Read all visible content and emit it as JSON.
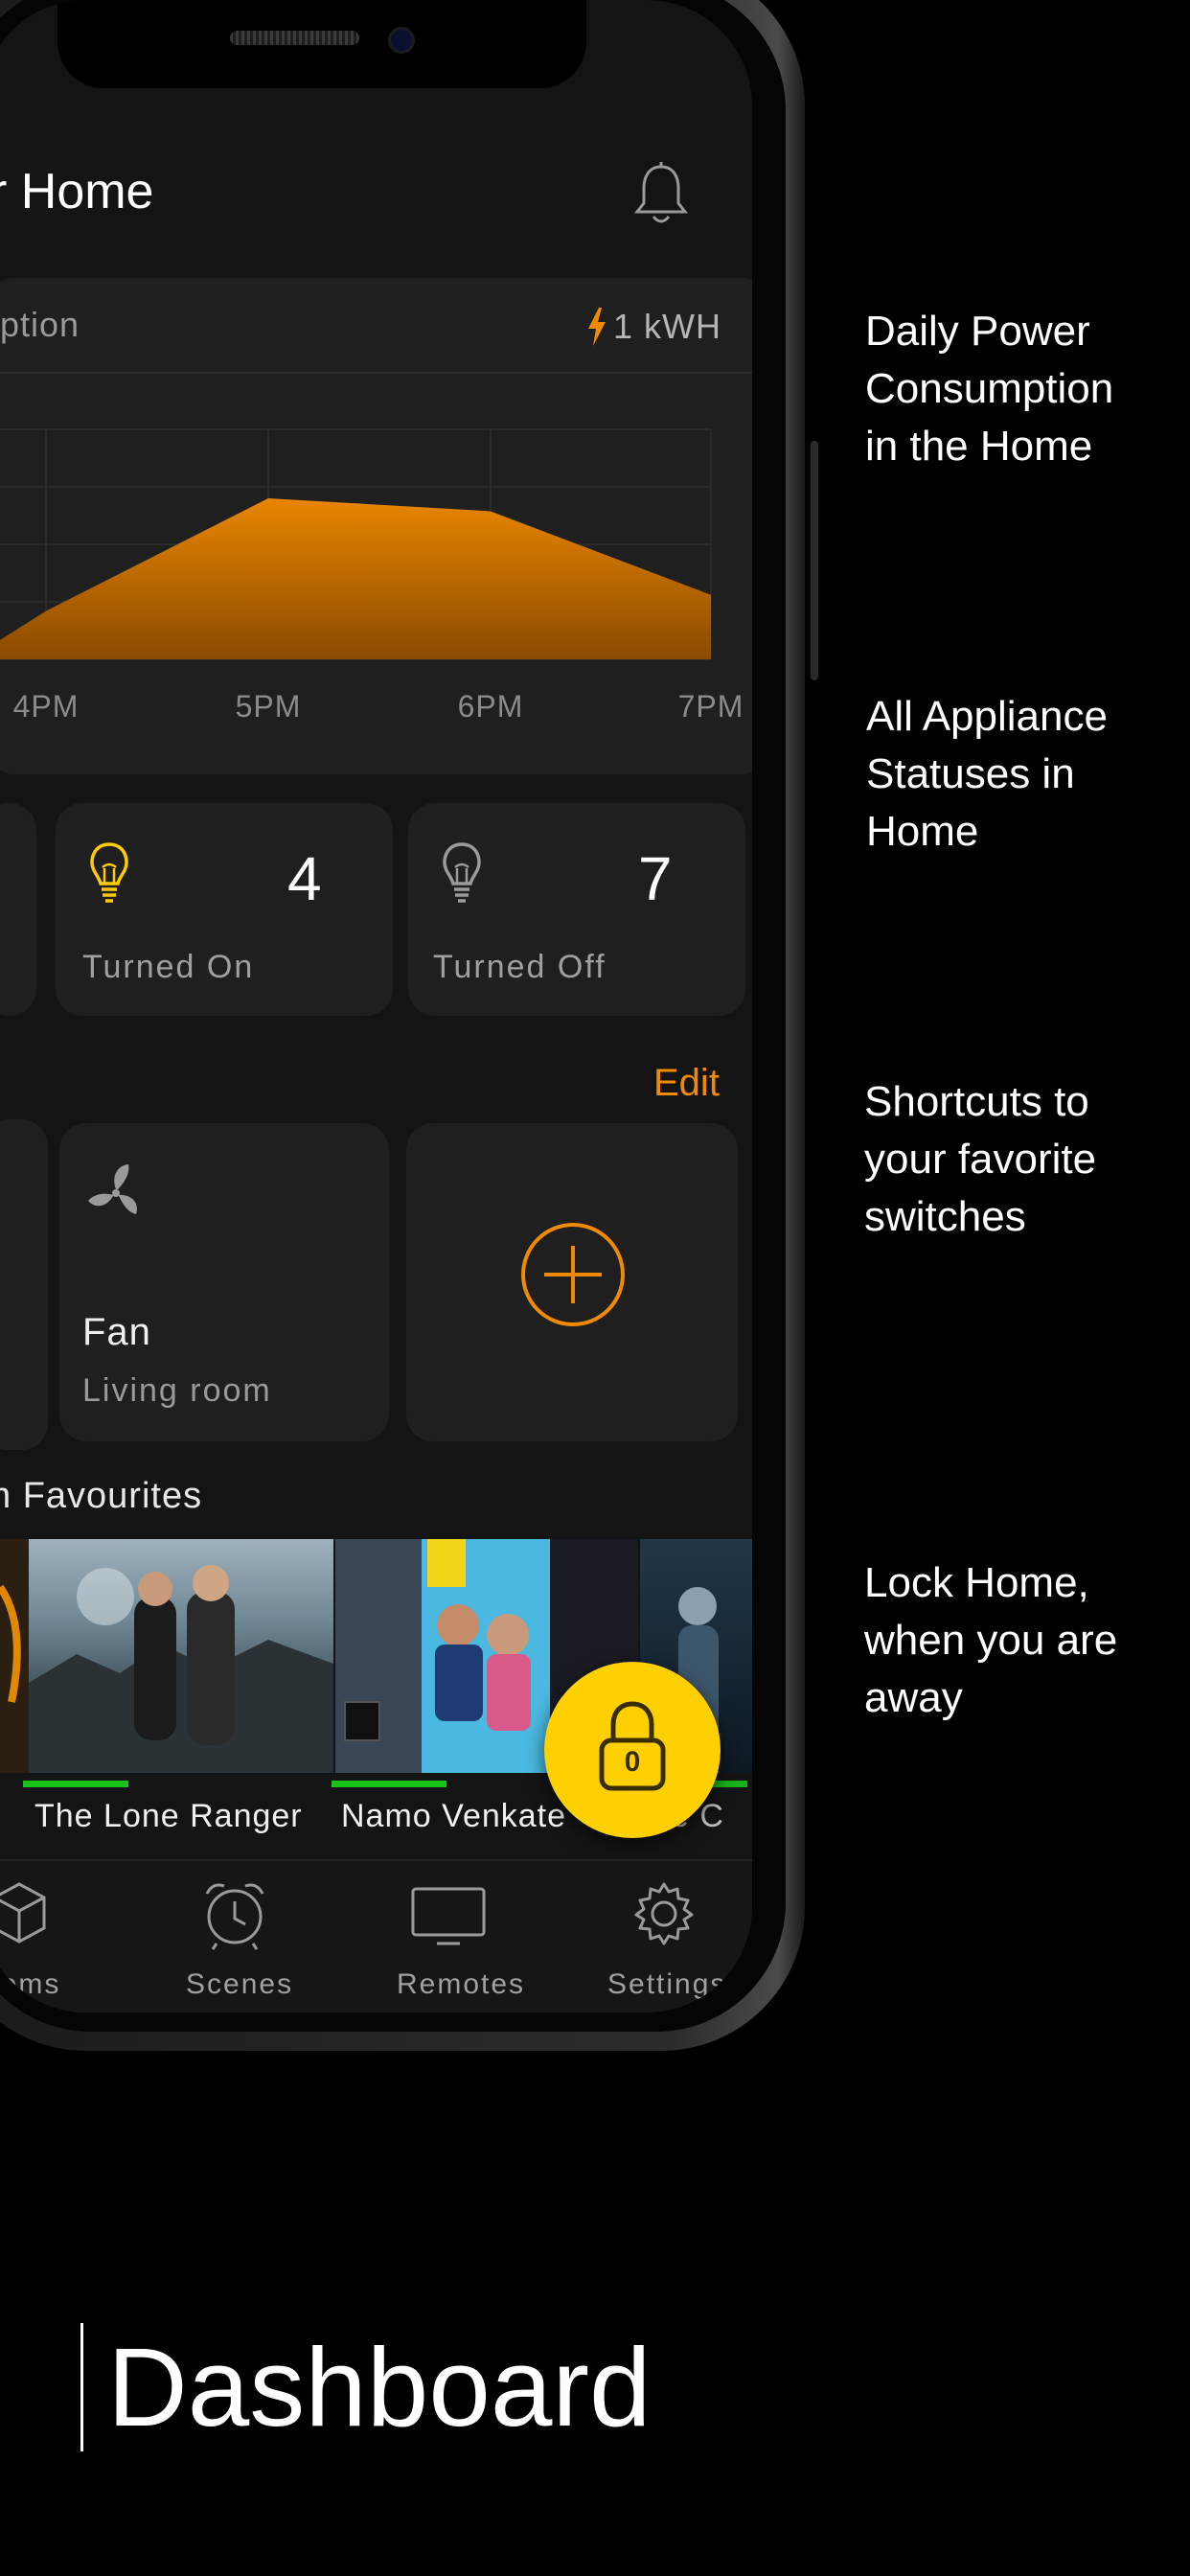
{
  "header": {
    "title": "r Home",
    "bell_icon": "bell-icon"
  },
  "power_card": {
    "label": "ption",
    "value": "1 kWH",
    "accent_color": "#f08a00"
  },
  "chart_data": {
    "type": "area",
    "x": [
      "4PM",
      "5PM",
      "6PM",
      "7PM"
    ],
    "tick_labels": [
      "4PM",
      "5PM",
      "6PM",
      "7PM"
    ],
    "series": [
      {
        "values": [
          0.3,
          1.0,
          0.92,
          0.4
        ]
      }
    ],
    "grid": true
  },
  "stats": {
    "turned_on": {
      "count": "4",
      "label": "Turned On"
    },
    "turned_off": {
      "count": "7",
      "label": "Turned Off"
    }
  },
  "shortcuts": {
    "edit_label": "Edit",
    "fan": {
      "name": "Fan",
      "room": "Living room"
    },
    "add_icon": "plus-circle-icon"
  },
  "favourites": {
    "title": "n Favourites",
    "items": [
      {
        "title": "The Lone Ranger",
        "progress": 0.38
      },
      {
        "title": "Namo Venkate",
        "progress": 0.37
      },
      {
        "title": "e C",
        "progress": 0.2
      }
    ]
  },
  "lock": {
    "code": "0",
    "color": "#ffd000"
  },
  "tabs": [
    {
      "label": "ooms",
      "icon": "cube-icon"
    },
    {
      "label": "Scenes",
      "icon": "alarm-clock-icon"
    },
    {
      "label": "Remotes",
      "icon": "tv-icon"
    },
    {
      "label": "Settings",
      "icon": "gear-icon"
    }
  ],
  "captions": {
    "power": [
      "Daily Power",
      "Consumption",
      "in the Home"
    ],
    "appliances": [
      "All Appliance",
      "Statuses in",
      "Home"
    ],
    "shortcuts": [
      "Shortcuts to",
      "your favorite",
      "switches"
    ],
    "lock": [
      "Lock Home,",
      "when you are",
      "away"
    ]
  },
  "footer": {
    "title": "Dashboard"
  }
}
